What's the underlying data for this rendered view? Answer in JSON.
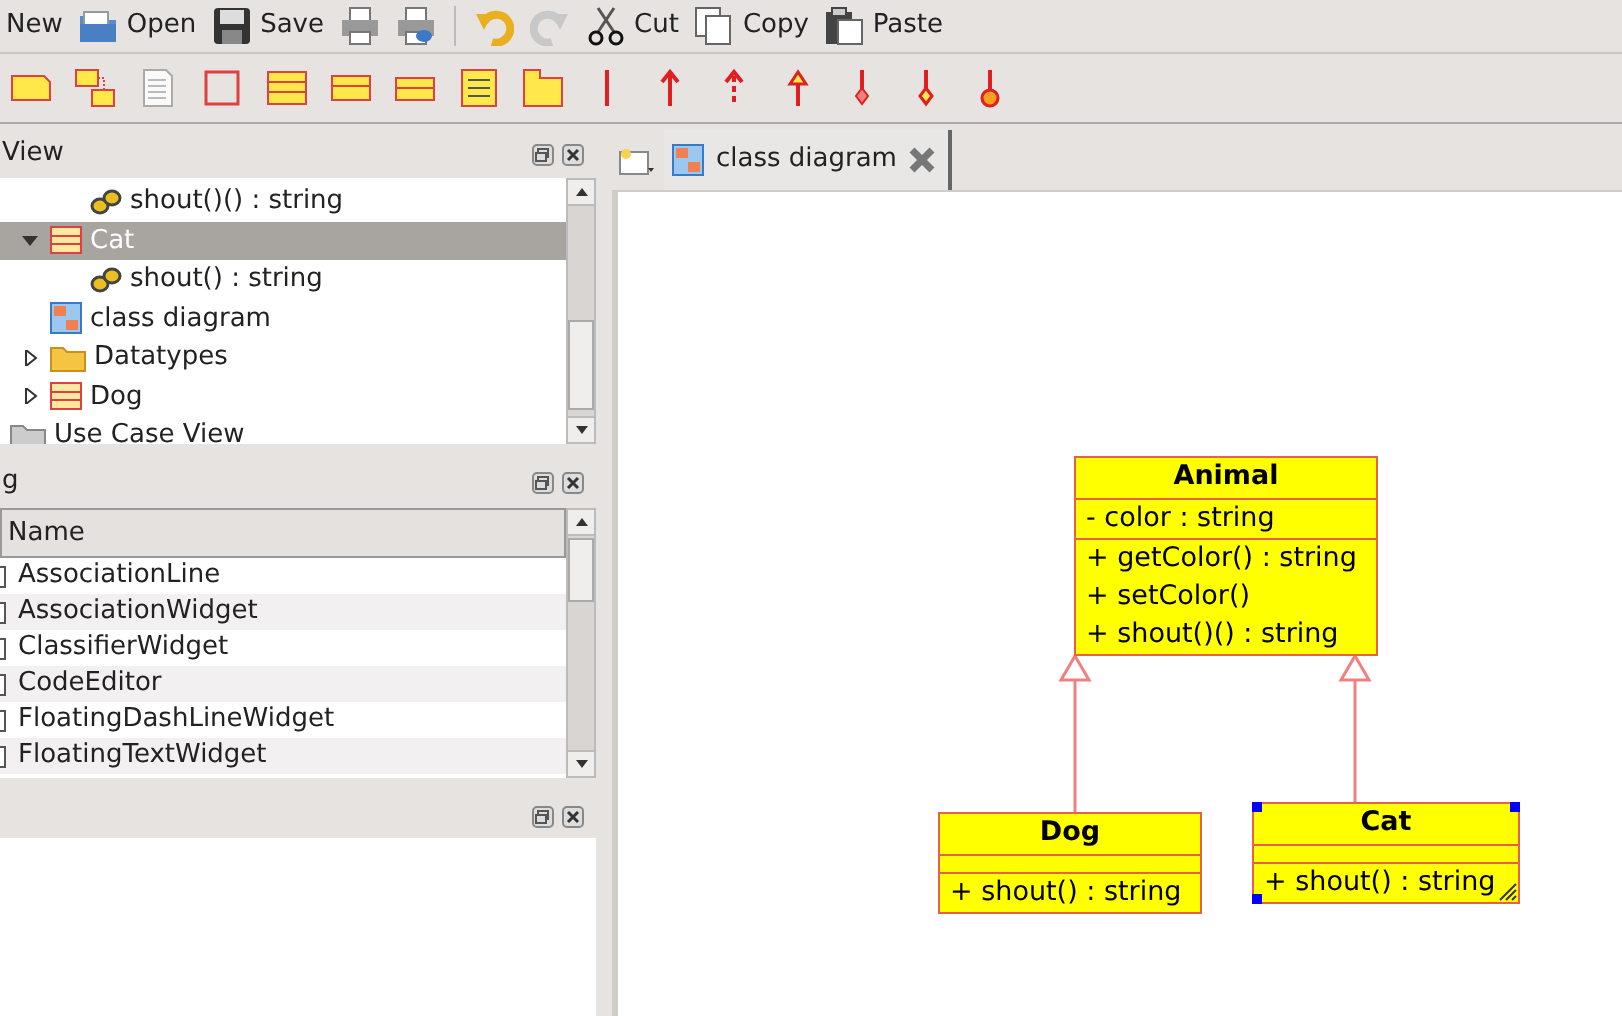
{
  "toolbar": {
    "buttons": [
      {
        "kind": "new",
        "label": "New"
      },
      {
        "kind": "open",
        "label": "Open"
      },
      {
        "kind": "save",
        "label": "Save"
      },
      {
        "kind": "print",
        "disabled": false
      },
      {
        "kind": "print-preview",
        "disabled": false
      },
      {
        "kind": "separator"
      },
      {
        "kind": "undo",
        "disabled": false
      },
      {
        "kind": "redo",
        "disabled": true
      },
      {
        "kind": "cut",
        "label": "Cut"
      },
      {
        "kind": "copy",
        "label": "Copy"
      },
      {
        "kind": "paste",
        "label": "Paste"
      }
    ]
  },
  "diagram_tools": [
    {
      "kind": "note"
    },
    {
      "kind": "diagram-link"
    },
    {
      "kind": "page"
    },
    {
      "kind": "box"
    },
    {
      "kind": "class"
    },
    {
      "kind": "interface"
    },
    {
      "kind": "datatype"
    },
    {
      "kind": "enum"
    },
    {
      "kind": "package"
    },
    {
      "kind": "line"
    },
    {
      "kind": "arrow"
    },
    {
      "kind": "dashed-arrow"
    },
    {
      "kind": "generalization"
    },
    {
      "kind": "composition"
    },
    {
      "kind": "aggregation"
    },
    {
      "kind": "containment"
    }
  ],
  "tree_dock": {
    "title": "View",
    "items": [
      {
        "children": [
          {
            "children": [
              {
                "label": "shout()() : string",
                "kind": "operation"
              }
            ]
          },
          {
            "label": "Cat",
            "kind": "class",
            "expanded": true,
            "selected": true,
            "children": [
              {
                "label": "shout() : string",
                "kind": "operation"
              }
            ]
          },
          {
            "label": "class diagram",
            "kind": "diagram"
          },
          {
            "label": "Datatypes",
            "kind": "folder",
            "expanded": false
          },
          {
            "label": "Dog",
            "kind": "class",
            "expanded": false
          }
        ]
      },
      {
        "label": "Use Case View",
        "kind": "view"
      }
    ]
  },
  "list_dock": {
    "title": "g",
    "column": "Name",
    "rows": [
      {
        "name": "AssociationLine",
        "checked": false
      },
      {
        "name": "AssociationWidget",
        "checked": false
      },
      {
        "name": "ClassifierWidget",
        "checked": false
      },
      {
        "name": "CodeEditor",
        "checked": false
      },
      {
        "name": "FloatingDashLineWidget",
        "checked": false
      },
      {
        "name": "FloatingTextWidget",
        "checked": false
      }
    ]
  },
  "tabs": [
    {
      "label": "class diagram",
      "selected": true
    }
  ],
  "classes": [
    {
      "name": "Animal",
      "attributes": [
        "- color : string"
      ],
      "operations": [
        "+ getColor() : string",
        "+ setColor()",
        "+ shout()() : string"
      ],
      "selected": false,
      "generalization": false
    },
    {
      "name": "Dog",
      "operations": [
        "+ shout() : string"
      ],
      "selected": false,
      "generalization": true
    },
    {
      "name": "Cat",
      "operations": [
        "+ shout() : string"
      ],
      "selected": true,
      "generalization": true
    }
  ]
}
